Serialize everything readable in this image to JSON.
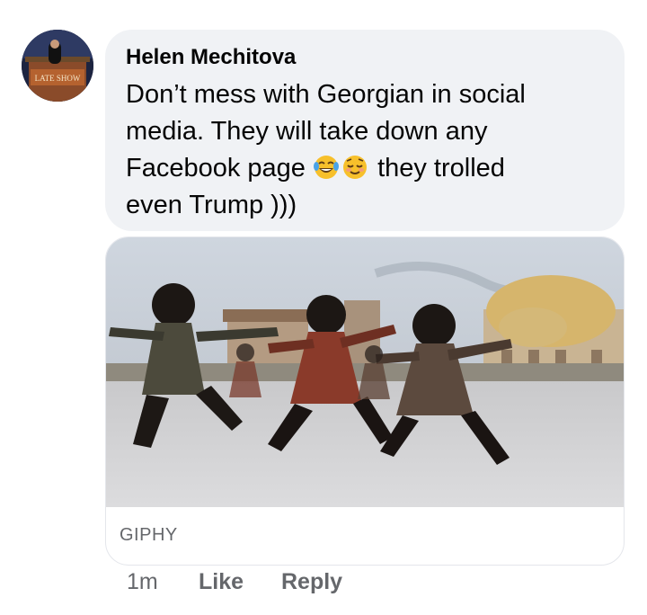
{
  "comment": {
    "author": "Helen Mechitova",
    "line1": "Don’t mess with Georgian in social",
    "line2": "media.  They will take down any",
    "line3_before": "Facebook page",
    "line3_after": "they trolled",
    "line4": "even Trump )))",
    "emojis": [
      "face-with-tears-of-joy",
      "relieved-face"
    ]
  },
  "avatar": {
    "sign_text": "LATE SHOW"
  },
  "attachment": {
    "source": "GIPHY",
    "description_icon": "gif-dancers-image"
  },
  "actions": {
    "timestamp": "1m",
    "like_label": "Like",
    "reply_label": "Reply"
  },
  "colors": {
    "bubble_bg": "#f0f2f5",
    "text": "#050505",
    "secondary_text": "#65676b"
  }
}
